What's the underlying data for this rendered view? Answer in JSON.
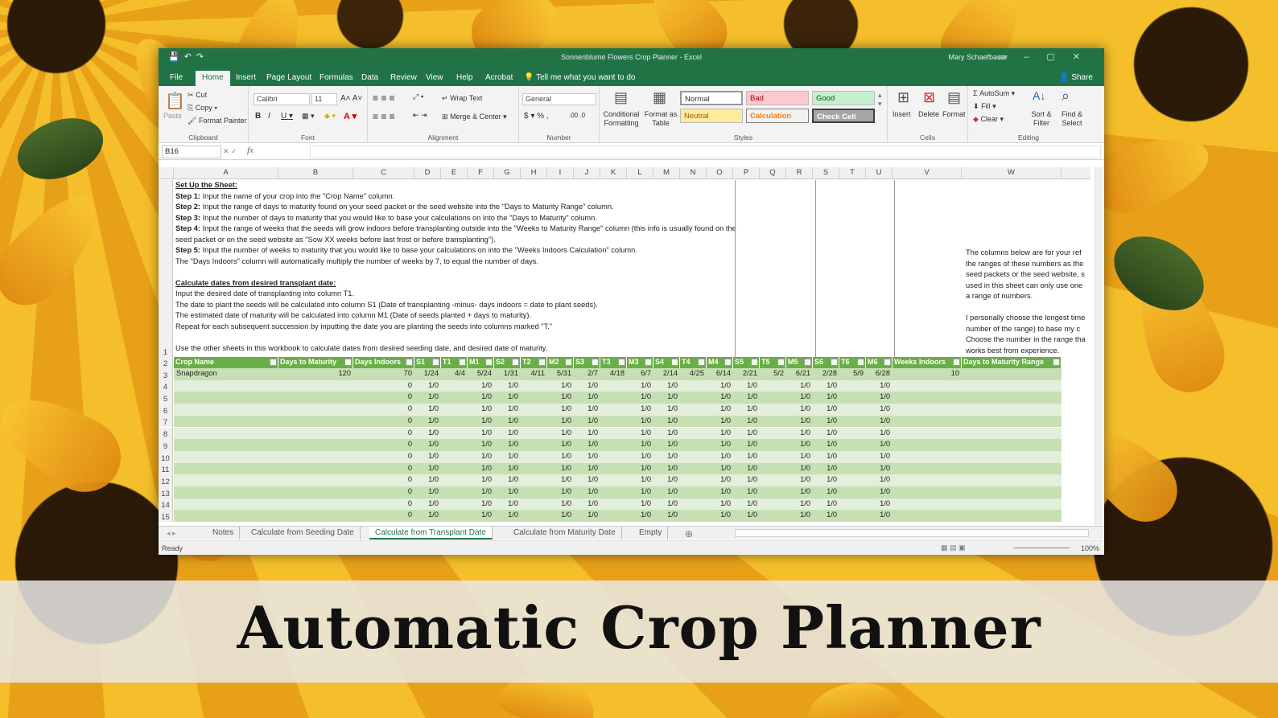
{
  "banner_title": "Automatic Crop Planner",
  "window": {
    "title": "Sonnenblume Flowers Crop Planner  -  Excel",
    "user": "Mary Schaefbauer"
  },
  "menu": {
    "tabs": [
      "File",
      "Home",
      "Insert",
      "Page Layout",
      "Formulas",
      "Data",
      "Review",
      "View",
      "Help",
      "Acrobat"
    ],
    "tell_me": "Tell me what you want to do",
    "share": "Share"
  },
  "ribbon": {
    "clipboard": {
      "label": "Clipboard",
      "paste": "Paste",
      "cut": "Cut",
      "copy": "Copy",
      "format_painter": "Format Painter"
    },
    "font": {
      "label": "Font",
      "name": "Calibri",
      "size": "11"
    },
    "alignment": {
      "label": "Alignment",
      "wrap": "Wrap Text",
      "merge": "Merge & Center"
    },
    "number": {
      "label": "Number",
      "format": "General"
    },
    "styles": {
      "label": "Styles",
      "conditional": "Conditional Formatting",
      "format_table": "Format as Table",
      "normal": "Normal",
      "bad": "Bad",
      "good": "Good",
      "neutral": "Neutral",
      "calculation": "Calculation",
      "check_cell": "Check Cell"
    },
    "cells": {
      "label": "Cells",
      "insert": "Insert",
      "delete": "Delete",
      "format": "Format"
    },
    "editing": {
      "label": "Editing",
      "autosum": "AutoSum",
      "fill": "Fill",
      "clear": "Clear",
      "sort": "Sort & Filter",
      "find": "Find & Select"
    }
  },
  "formula_bar": {
    "name_box": "B16",
    "fx": "fx",
    "formula": ""
  },
  "columns": [
    "A",
    "B",
    "C",
    "D",
    "E",
    "F",
    "G",
    "H",
    "I",
    "J",
    "K",
    "L",
    "M",
    "N",
    "O",
    "P",
    "Q",
    "R",
    "S",
    "T",
    "U",
    "V",
    "W"
  ],
  "instructions": {
    "setup_heading": "Set Up the Sheet:",
    "steps": [
      {
        "label": "Step 1:",
        "text": " Input the name of your crop into the \"Crop Name\" column."
      },
      {
        "label": "Step 2:",
        "text": " Input the range of days to maturity found on your seed packet or the seed website into the \"Days to Maturity Range\" column."
      },
      {
        "label": "Step 3:",
        "text": " Input the number of days to maturity that you would like to base your calculations on into the \"Days to Maturity\" column."
      },
      {
        "label": "Step 4:",
        "text": " Input the range of weeks that the seeds will grow indoors before transplanting outside into the \"Weeks to Maturity Range\" column (this info is usually found on the seed packet or on the seed website as \"Sow XX weeks before last frost  or before transplanting\")."
      },
      {
        "label": "Step 5:",
        "text": " Input the number of weeks to maturity that you would like to base your calculations on into the \"Weeks Indoors Calculation\" column."
      }
    ],
    "days_indoors_note": "The \"Days Indoors\" column will automatically multiply the number of weeks by 7, to equal the number of days.",
    "calc_heading": "Calculate dates from desired transplant date:",
    "calc_lines": [
      "Input the desired date of transplanting into column T1.",
      "The date to plant the seeds will be calculated into column S1 (Date of transplanting -minus- days indoors = date to plant seeds).",
      "The estimated date of maturity will be calculated into column M1 (Date of seeds planted + days to maturity).",
      "Repeat for each subsequent succession by inputting the date you are planting the seeds into columns marked \"T.\""
    ],
    "other_sheets": "Use the other sheets in this workbook to calculate dates from desired seeding date, and desired date of maturity."
  },
  "side_note": [
    "The columns below are for your ref",
    "the ranges of these numbers as the",
    "seed packets or the seed website, s",
    "used in this sheet can only use one",
    "a range of numbers.",
    "",
    "I personally choose the longest time",
    "number of the range) to base my c",
    "Choose the number in the range tha",
    "works best from experience."
  ],
  "table": {
    "headers": [
      "Crop Name",
      "Days to Maturity",
      "Days Indoors",
      "S1",
      "T1",
      "M1",
      "S2",
      "T2",
      "M2",
      "S3",
      "T3",
      "M3",
      "S4",
      "T4",
      "M4",
      "S5",
      "T5",
      "M5",
      "S6",
      "T6",
      "M6",
      "Weeks Indoors",
      "Days to Maturity Range",
      "Weeks"
    ],
    "row_numbers": [
      "3",
      "4",
      "5",
      "6",
      "7",
      "8",
      "9",
      "10",
      "11",
      "12",
      "13",
      "14",
      "15"
    ],
    "first_row": [
      "Snapdragon",
      "120",
      "70",
      "1/24",
      "4/4",
      "5/24",
      "1/31",
      "4/11",
      "5/31",
      "2/7",
      "4/18",
      "6/7",
      "2/14",
      "4/25",
      "6/14",
      "2/21",
      "5/2",
      "6/21",
      "2/28",
      "5/9",
      "6/28",
      "10",
      "",
      ""
    ],
    "empty_row": [
      "",
      "",
      "0",
      "1/0",
      "",
      "1/0",
      "1/0",
      "",
      "1/0",
      "1/0",
      "",
      "1/0",
      "1/0",
      "",
      "1/0",
      "1/0",
      "",
      "1/0",
      "1/0",
      "",
      "1/0",
      "",
      "",
      ""
    ]
  },
  "sheet_tabs": [
    "Notes",
    "Calculate from Seeding Date",
    "Calculate from Transplant Date",
    "Calculate from Maturity Date",
    "Empty"
  ],
  "active_sheet": "Calculate from Transplant Date",
  "status": {
    "ready": "Ready",
    "zoom": "100%"
  },
  "colors": {
    "excel_green": "#217346",
    "table_header": "#6aae47",
    "row_dark": "#c6e0b4",
    "row_light": "#e2efda"
  }
}
